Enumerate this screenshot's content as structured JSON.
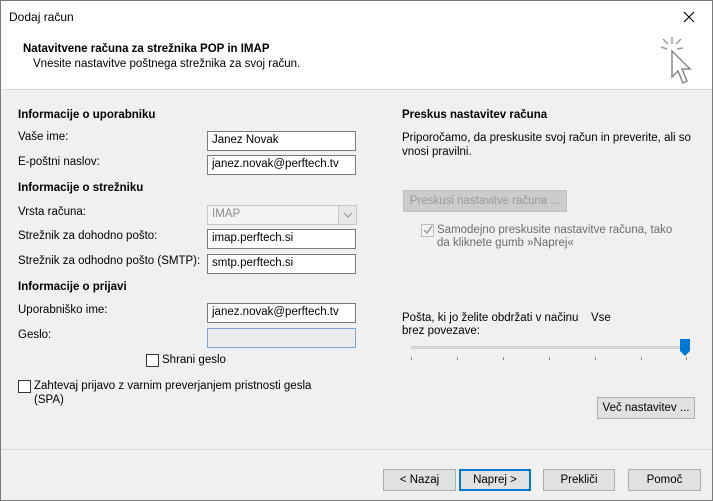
{
  "window": {
    "title": "Dodaj račun",
    "close_icon": "close-icon"
  },
  "header": {
    "title": "Natavitvene računa za strežnika POP in IMAP",
    "subtitle": "Vnesite nastavitve poštnega strežnika za svoj račun.",
    "icon": "cursor-click-icon"
  },
  "user_info": {
    "section_label": "Informacije o uporabniku",
    "name_label": "Vaše ime:",
    "name_value": "Janez Novak",
    "email_label": "E-poštni naslov:",
    "email_value": "janez.novak@perftech.tv"
  },
  "server_info": {
    "section_label": "Informacije o strežniku",
    "account_type_label": "Vrsta računa:",
    "account_type_value": "IMAP",
    "incoming_label": "Strežnik za dohodno pošto:",
    "incoming_value": "imap.perftech.si",
    "outgoing_label": "Strežnik za odhodno pošto (SMTP):",
    "outgoing_value": "smtp.perftech.si"
  },
  "login_info": {
    "section_label": "Informacije o prijavi",
    "username_label": "Uporabniško ime:",
    "username_value": "janez.novak@perftech.tv",
    "password_label": "Geslo:",
    "password_value": "",
    "remember_label": "Shrani geslo",
    "spa_label_line1": "Zahtevaj prijavo z varnim preverjanjem pristnosti gesla",
    "spa_label_line2": "(SPA)"
  },
  "test_settings": {
    "section_label": "Preskus nastavitev računa",
    "description_line1": "Priporočamo, da preskusite svoj račun in preverite, ali so",
    "description_line2": "vnosi pravilni.",
    "test_button": "Preskusi nastavitve računa ...",
    "auto_test_line1": "Samodejno preskusite nastavitve računa, tako",
    "auto_test_line2": "da kliknete gumb »Naprej«",
    "auto_test_checked": true
  },
  "offline": {
    "label_line1": "Pošta, ki jo želite obdržati v načinu",
    "label_value": "Vse",
    "label_line2": "brez povezave:",
    "slider_level": 1.0
  },
  "more_settings_button": "Več nastavitev ...",
  "footer": {
    "back": "< Nazaj",
    "next": "Naprej >",
    "cancel": "Prekliči",
    "help": "Pomoč"
  }
}
